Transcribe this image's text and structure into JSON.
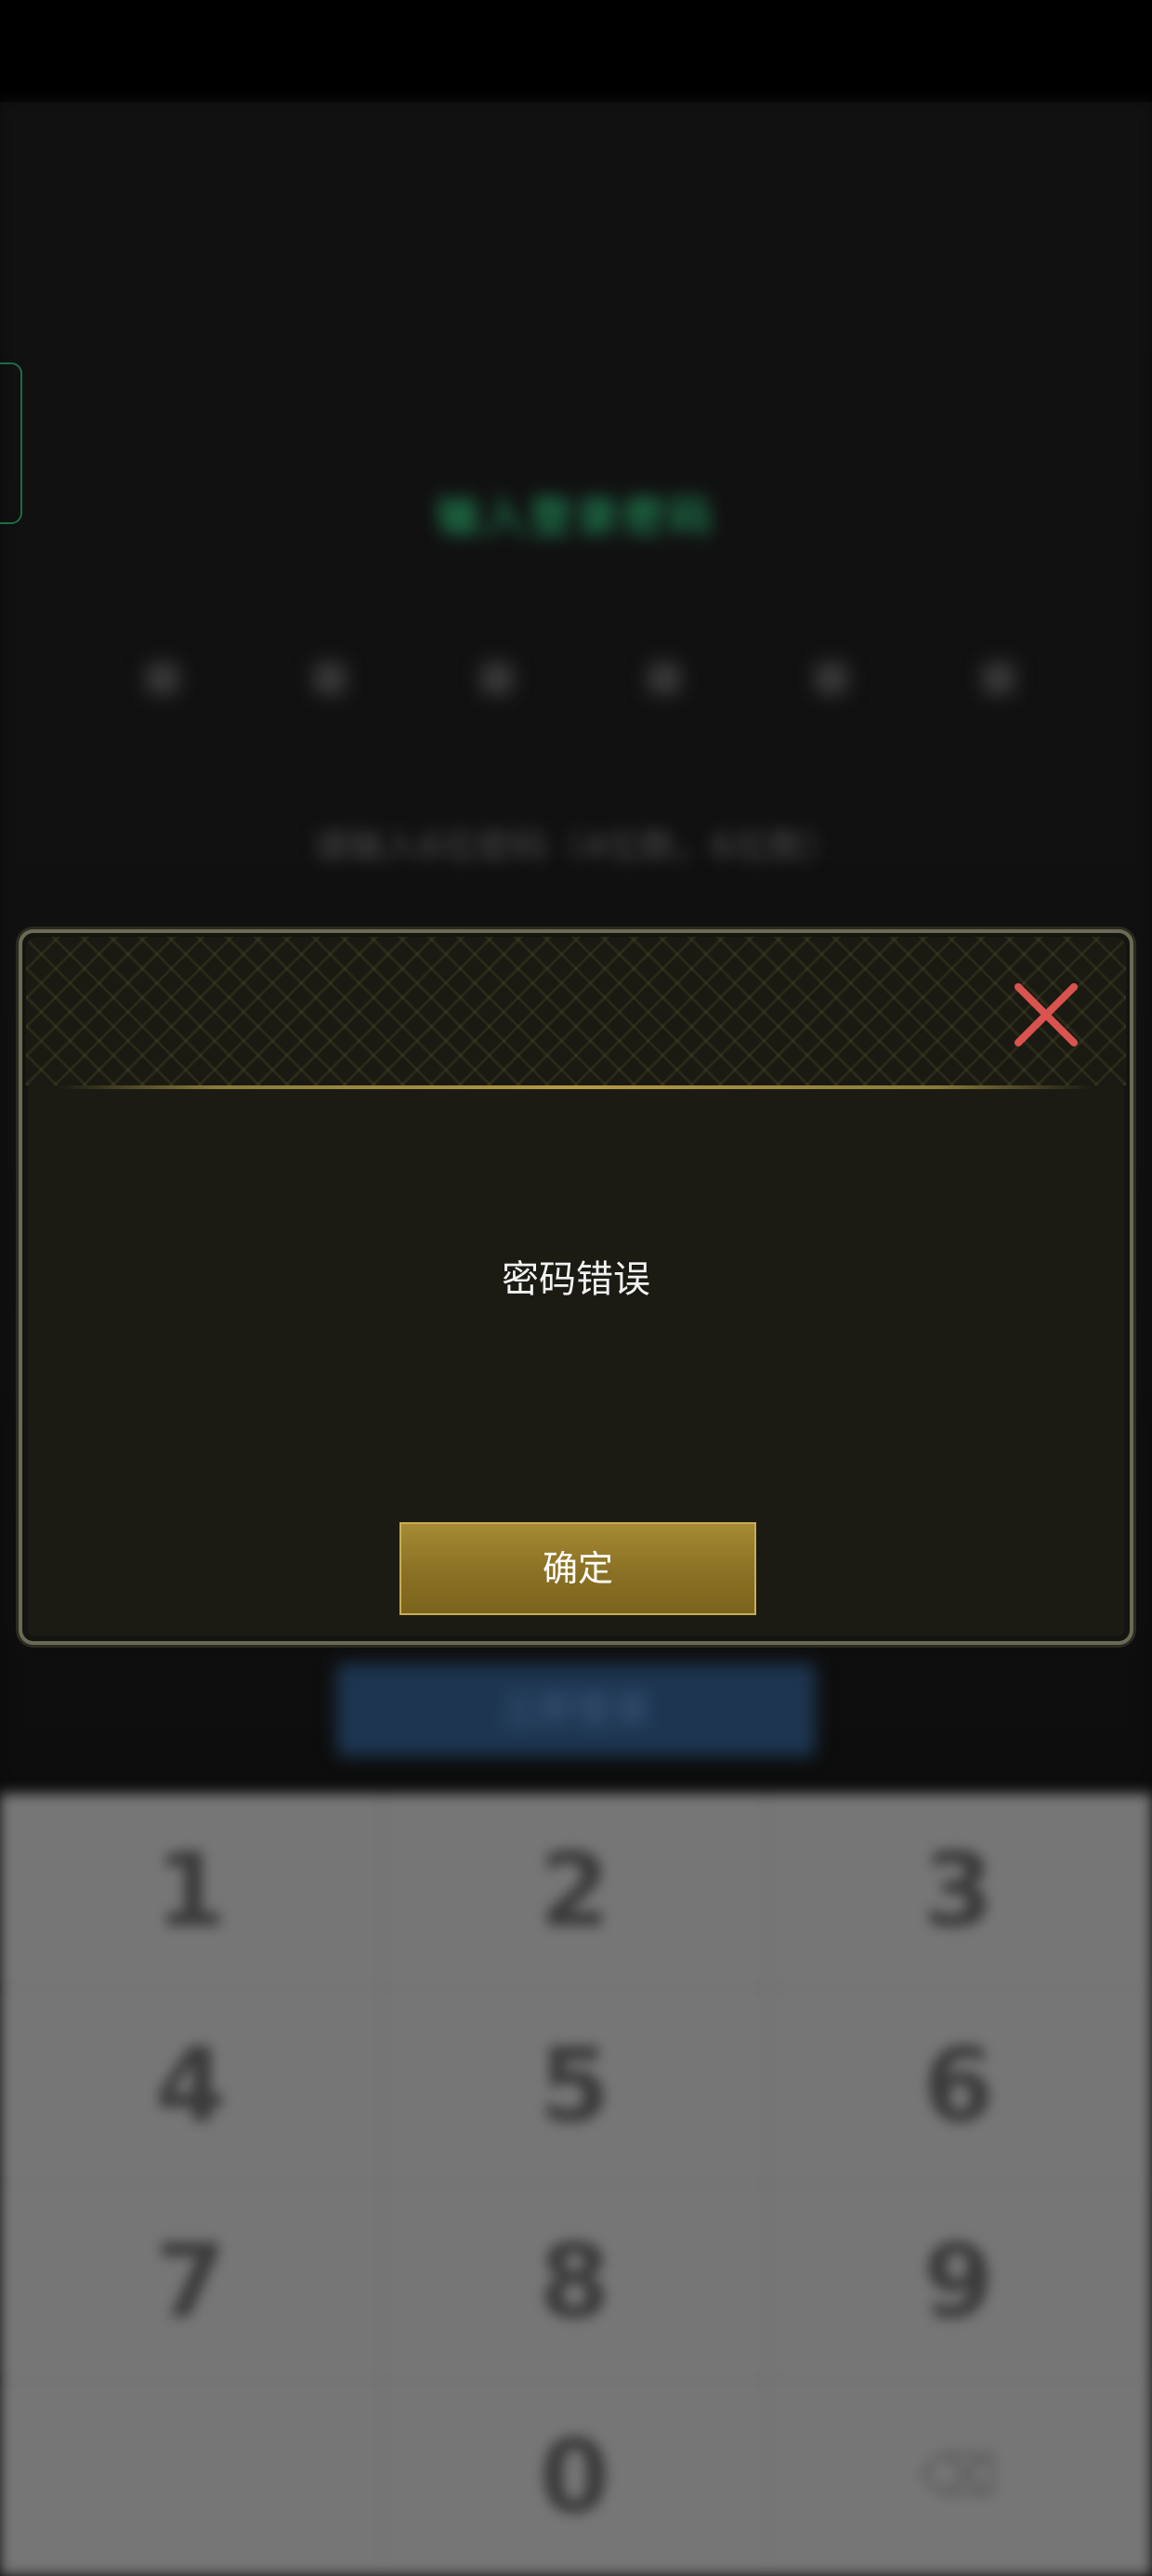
{
  "background": {
    "title": "输入登录密码",
    "hint": "请输入6位密码（4位数，6位数）",
    "submit_label": "立即登录",
    "keypad": {
      "keys": [
        "1",
        "2",
        "3",
        "4",
        "5",
        "6",
        "7",
        "8",
        "9",
        "",
        "0",
        "⌫"
      ]
    }
  },
  "dialog": {
    "message": "密码错误",
    "confirm_label": "确定",
    "close_icon": "close-icon",
    "close_color": "#d9534f",
    "button_color": "#8a7023"
  }
}
